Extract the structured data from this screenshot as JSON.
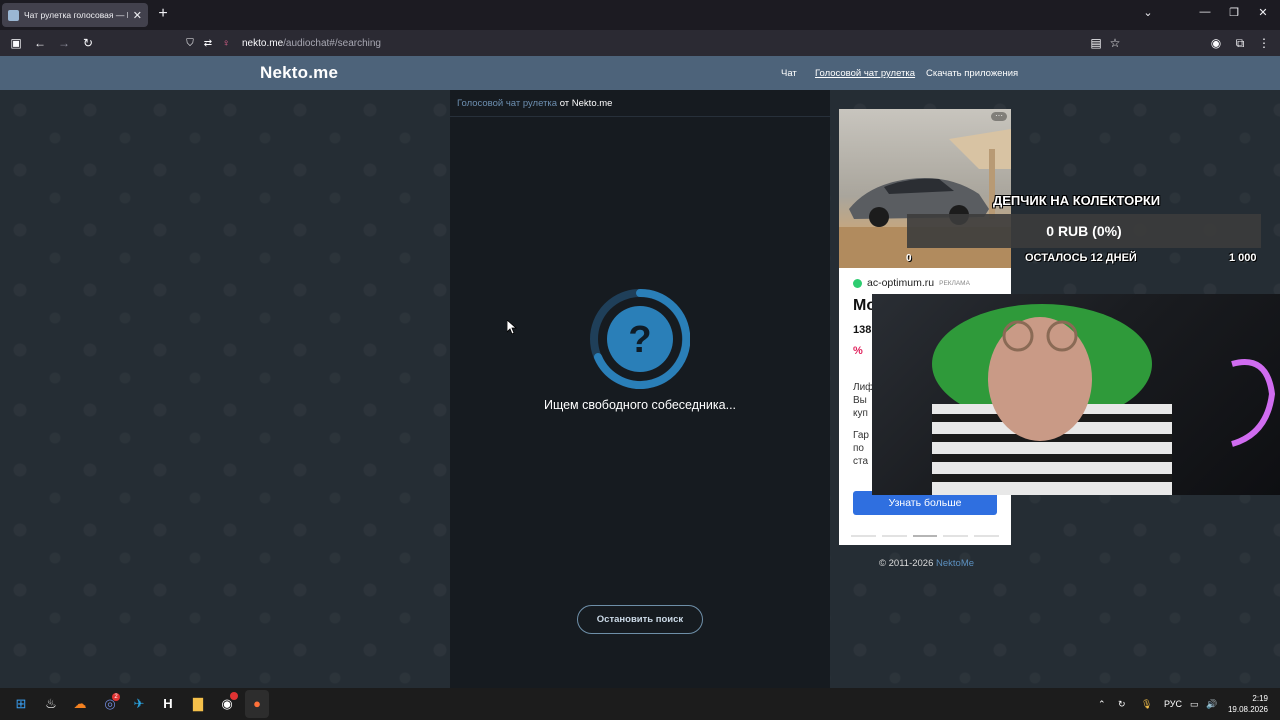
{
  "browser": {
    "tab_title": "Чат рулетка голосовая — Nekto.me",
    "new_tab": "+",
    "url_domain": "nekto.me",
    "url_path": "/audiochat#/searching"
  },
  "site": {
    "logo": "Nekto.me",
    "nav": {
      "chat": "Чат",
      "voice": "Голосовой чат рулетка",
      "apps": "Скачать приложения"
    }
  },
  "chat": {
    "breadcrumb_link": "Голосовой чат рулетка",
    "breadcrumb_rest": " от Nekto.me",
    "status": "Ищем свободного собеседника...",
    "spinner_glyph": "?",
    "stop_button": "Остановить поиск"
  },
  "ad": {
    "domain": "ac-optimum.ru",
    "tag": "РЕКЛАМА",
    "heading": "Mo",
    "price": "138",
    "pct": "%",
    "text1": "Лиф",
    "text2": "Вы",
    "text3": "куп",
    "text4": "Гар",
    "text5": "по",
    "text6": "ста",
    "cta": "Узнать больше"
  },
  "copyright": {
    "text": "© 2011-2026 ",
    "link": "NektoMe"
  },
  "overlay": {
    "title": "ДЕПЧИК НА КОЛЕКТОРКИ",
    "amount": "0 RUB (0%)",
    "start": "0",
    "days": "ОСТАЛОСЬ 12 ДНЕЙ",
    "goal": "1 000"
  },
  "taskbar": {
    "discord_badge": "2",
    "lang": "РУС",
    "time": "2:19",
    "date": "19.08.2026"
  },
  "colors": {
    "site_header": "#4d637a",
    "chat_panel": "#161b20",
    "spinner_blue": "#2a7fb8",
    "cta_blue": "#2f6fe0"
  }
}
